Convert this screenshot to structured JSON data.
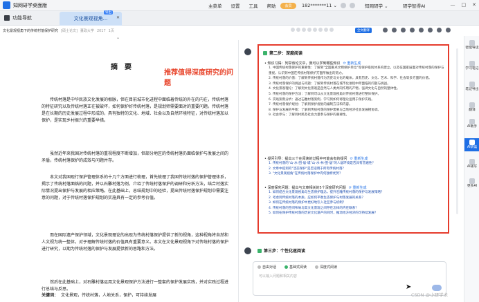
{
  "app": {
    "title": "知网研学桌面版"
  },
  "menu": [
    "主菜单",
    "设置",
    "工具",
    "帮助"
  ],
  "vip_label": "会员",
  "user": "182*******11 ⌄",
  "brands": [
    "知网研学 ⌄",
    "研学智得AI"
  ],
  "window_controls": [
    "—",
    "□",
    "✕"
  ],
  "tabs": {
    "nav": "功能导航",
    "active": "文化景观视角...",
    "badge": "导出"
  },
  "docbar": {
    "path": "文化景观视角下的传统村落保护研究",
    "type": "[硕士论文]",
    "author": "董政大学",
    "year": "2017",
    "pages": "1页"
  },
  "fulltext_btn": "全文翻译",
  "document": {
    "heading": "摘　要",
    "annotation": "推荐值得深度研究的问题",
    "paragraphs": [
      "传统村落是中华民族文化发展的根脉，但在目前城市化进程中面临着传统的外在的内在，传统村落的特征研究以及传统村落正在被破坏，如何保护好传统村落，是规划师需要面对的重要问题。传统村落是在长期的历史发展过程中形成的，具有独特的文化、地域、社会以及自然环境特征，对传统村落加以保护，是实现乡村振兴的重要举措。",
      "虽然近年来我国对传统村落的重视程度不断增加，但部分地区的传统村落仍面临保护与发展之间的矛盾，传统村落保护的成效与问题并存。",
      "本文对我国现行保护管理体系的十几个方面进行梳理，首先梳理了我国传统村落的保护管理体系，揭示了传统村落面临的问题，并以石雕村落为例，介绍了传统村落保护的调研和分析方法，结合村落实际情况提出保护与发展的相应策略。在此基础上，总结规划中的经验，提出传统村落保护规划中需要注意的问题，对于传统村落保护规划的实施具有一定的参考价值。",
      "而在国际遗产保护领域，文化景观理论的出现为传统村落保护提供了新的视角，这种视角将自然和人文视为统一整体，对于理解传统村落的价值具有重要意义。本文在文化景观视角下对传统村落的保护进行研究，以期为传统村落的保护与发展提供新的思路和方法。",
      "然后在此基础上，对石雕村落运用文化景观保护方法进行一整套的保护发展实践，并对实践过程进行总结与反思。"
    ],
    "keywords_label": "关键词：",
    "keywords": "文化景观，传统村落，人地关系，保护，可持续发展"
  },
  "ai_panel": {
    "step2_title": "第二步：深度阅读",
    "section1": {
      "title": "知识习得：列举该论文中，我可以学到哪些知识",
      "redo": "⟳ 重新生成"
    },
    "list1": [
      "1. 中国传统村落保护的重要性：了解到\"全国重点文物保护单位\"等保护级别体系的建立，以及在国家层面对传统村落的保护与重视，认识到中国在传统村落保护方面所做出的努力。",
      "2. 传统村落的价值：了解到传统村落作为历史与文化的载体，具有历史、文化、艺术、科学、社会等多方面的价值。",
      "3. 传统村落保护的挑战与问题：了解到传统村落在城市化进程中所面临的问题与挑战。",
      "4. 文化景观理论：了解到文化景观是自然与人类共同作用的产物，强调文化与自然的整体性。",
      "5. 传统村落的保护方法：了解到可以从文化景观视角对传统村落进行整体保护。",
      "6. 实践案例分析：通过石雕村落案例，学习到如何将理论运用于保护实践。",
      "7. 传统村落保护规划：了解到保护规划的编制方法和内容。",
      "8. 保护与发展的平衡：了解到传统村落的保护需要与当地经济社会发展相协调。",
      "9. 社会参与：了解到村民及社会力量参与保护的重要性。"
    ],
    "section2": {
      "title": "疑问引导：提出三个在阅读的过程中可能会有的疑问",
      "redo": "⟳ 重新生成"
    },
    "list2": [
      "1. 传统村落的\"山-水-田-居-城\"山-水-林-田-居\"的人居环境是否具有普遍性？",
      "2. 文章中提到的\"活态保护\"是否适用于所有传统村落？",
      "3. \"文化景观视角\"在传统村落保护中有何独特优势？"
    ],
    "section3": {
      "title": "深度探究问题：提出与文章相关的5个深度研究问题",
      "redo": "⟳ 重新生成"
    },
    "list3": [
      "1. 如何结合文化景观视角与生态保护理念，提升石雕传统村落的保护与发展策略？",
      "2. 考虑到传统村落的本质，应如何平衡生态保护与村落发展的关系？",
      "3. 如何在传统村落的保护中更好地引入社区参与机制？",
      "4. 传统村落的空间布局与其文化景观之间存在怎样的内在联系？",
      "5. 如何在保护传统村落的历史文化遗产的同时，推动地方经济的可持续发展？"
    ]
  },
  "step3": {
    "title": "第三步：个性化逐阅读",
    "modes": [
      "自由对话",
      "基础式阅读",
      "深度式阅读"
    ],
    "placeholder": "可以输入问题和相关内容"
  },
  "sidebar": [
    "智能导读",
    "学习笔记",
    "笔记导出",
    "翻译",
    "AI助手",
    "AI研读",
    "AI辅写",
    "更多AI"
  ],
  "watermark": "CSDN @小研学术"
}
